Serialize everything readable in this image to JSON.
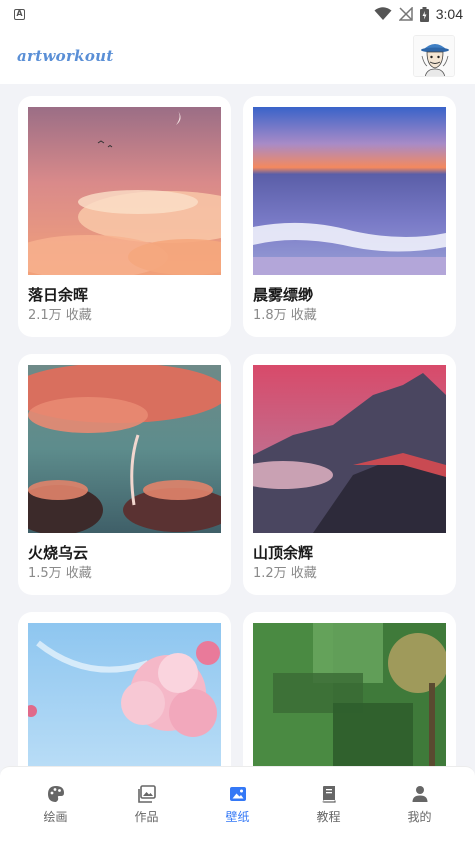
{
  "status_bar": {
    "time": "3:04"
  },
  "header": {
    "logo_text": "artworkout"
  },
  "wallpapers": [
    {
      "title": "落日余晖",
      "count": "2.1万",
      "label": "收藏"
    },
    {
      "title": "晨雾缥缈",
      "count": "1.8万",
      "label": "收藏"
    },
    {
      "title": "火烧乌云",
      "count": "1.5万",
      "label": "收藏"
    },
    {
      "title": "山顶余辉",
      "count": "1.2万",
      "label": "收藏"
    },
    {
      "title": "",
      "count": "",
      "label": ""
    },
    {
      "title": "",
      "count": "",
      "label": ""
    }
  ],
  "bottom_nav": {
    "items": [
      {
        "label": "绘画",
        "icon": "palette-icon"
      },
      {
        "label": "作品",
        "icon": "gallery-icon"
      },
      {
        "label": "壁纸",
        "icon": "image-icon"
      },
      {
        "label": "教程",
        "icon": "book-icon"
      },
      {
        "label": "我的",
        "icon": "person-icon"
      }
    ],
    "active": "壁纸",
    "active_color": "#3478f6",
    "inactive_color": "#666666"
  }
}
